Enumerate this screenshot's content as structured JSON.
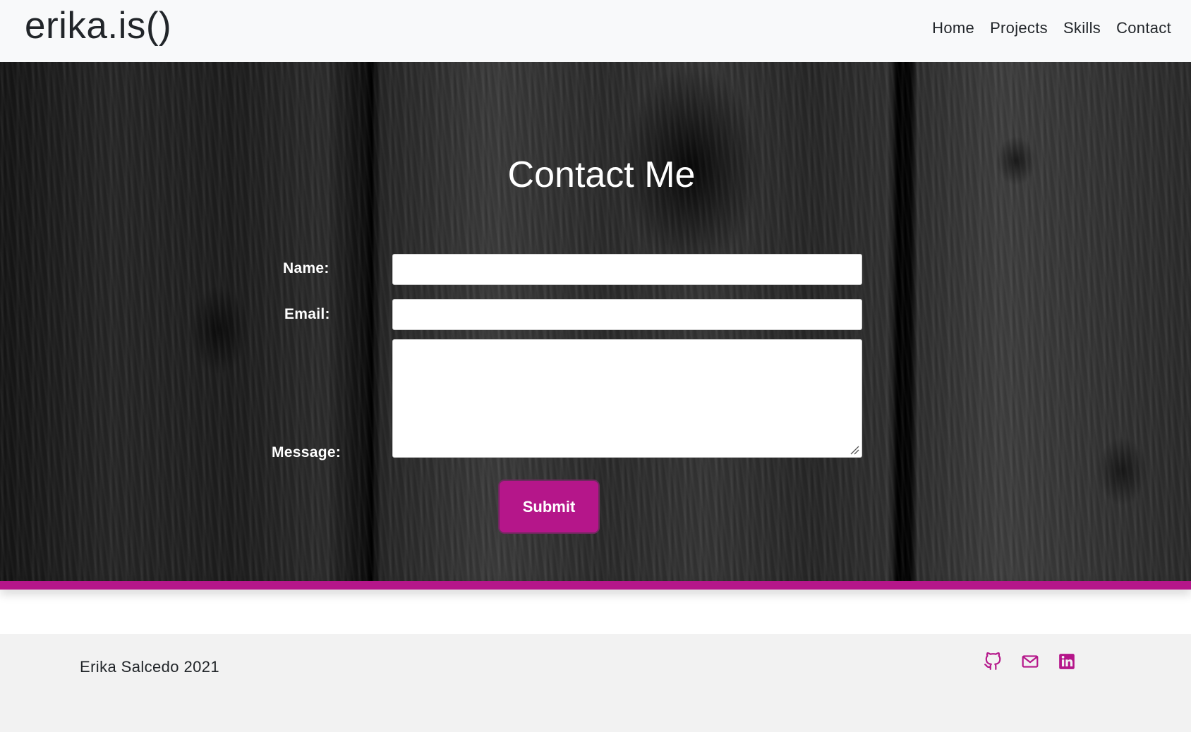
{
  "header": {
    "brand": "erika.is()",
    "nav": [
      "Home",
      "Projects",
      "Skills",
      "Contact"
    ]
  },
  "contact": {
    "title": "Contact Me",
    "name_label": "Name:",
    "email_label": "Email:",
    "message_label": "Message:",
    "name_value": "",
    "email_value": "",
    "message_value": "",
    "submit_label": "Submit"
  },
  "footer": {
    "copyright": "Erika Salcedo 2021",
    "social_icons": [
      "github-icon",
      "mail-icon",
      "linkedin-icon"
    ]
  },
  "colors": {
    "accent": "#b5168a",
    "navbar_bg": "#f8f9fa",
    "footer_bg": "#f2f2f2",
    "text_dark": "#212529"
  }
}
